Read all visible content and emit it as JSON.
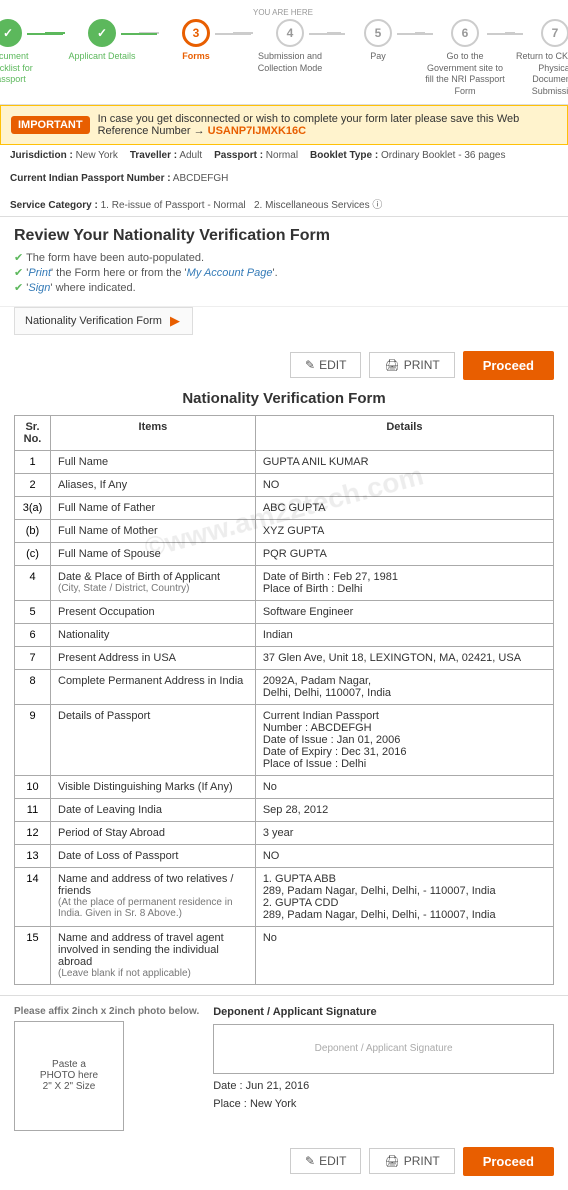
{
  "meta": {
    "you_are_here": "YOU ARE HERE"
  },
  "progress": {
    "steps": [
      {
        "id": 1,
        "label": "Document Checklist for Passport",
        "state": "completed",
        "check": true
      },
      {
        "id": 2,
        "label": "Applicant Details",
        "state": "completed",
        "check": true
      },
      {
        "id": 3,
        "label": "Forms",
        "state": "active"
      },
      {
        "id": 4,
        "label": "Submission and Collection Mode",
        "state": "future"
      },
      {
        "id": 5,
        "label": "Pay",
        "state": "future"
      },
      {
        "id": 6,
        "label": "Go to the Government site to fill the NRI Passport Form",
        "state": "future"
      },
      {
        "id": 7,
        "label": "Return to CKGS for Physical Documents Submission",
        "state": "future"
      }
    ]
  },
  "banner": {
    "label": "IMPORTANT",
    "text": "In case you get disconnected or wish to complete your form later please save this Web Reference Number →",
    "ref_number": "USANP7IJMXK16C"
  },
  "jurisdiction": {
    "jurisdiction_label": "Jurisdiction",
    "jurisdiction_value": "New York",
    "traveller_label": "Traveller",
    "traveller_value": "Adult",
    "passport_label": "Passport",
    "passport_value": "Normal",
    "booklet_label": "Booklet Type",
    "booklet_value": "Ordinary Booklet - 36 pages",
    "passport_number_label": "Current Indian Passport Number",
    "passport_number_value": "ABCDEFGH",
    "service_label": "Service Category",
    "service_value": "1. Re-issue of Passport - Normal\n2. Miscellaneous Services"
  },
  "review": {
    "title": "Review Your Nationality Verification Form",
    "checklist": [
      "The form have been auto-populated.",
      "'Print' the Form here or from the 'My Account Page'.",
      "'Sign' where indicated."
    ]
  },
  "form_tab": {
    "label": "Nationality Verification Form"
  },
  "buttons": {
    "edit": "EDIT",
    "print": "PRINT",
    "proceed": "Proceed"
  },
  "form": {
    "title": "Nationality Verification Form",
    "headers": [
      "Sr. No.",
      "Items",
      "Details"
    ],
    "rows": [
      {
        "sr": "1",
        "item": "Full Name",
        "sub": "",
        "detail": "GUPTA ANIL KUMAR"
      },
      {
        "sr": "2",
        "item": "Aliases, If Any",
        "sub": "",
        "detail": "NO"
      },
      {
        "sr": "3(a)",
        "item": "Full Name of Father",
        "sub": "",
        "detail": "ABC GUPTA"
      },
      {
        "sr": "(b)",
        "item": "Full Name of Mother",
        "sub": "",
        "detail": "XYZ GUPTA"
      },
      {
        "sr": "(c)",
        "item": "Full Name of Spouse",
        "sub": "",
        "detail": "PQR GUPTA"
      },
      {
        "sr": "4",
        "item": "Date & Place of Birth of Applicant",
        "sub": "(City, State / District, Country)",
        "detail": "Date of Birth : Feb 27, 1981\nPlace of Birth : Delhi"
      },
      {
        "sr": "5",
        "item": "Present Occupation",
        "sub": "",
        "detail": "Software Engineer"
      },
      {
        "sr": "6",
        "item": "Nationality",
        "sub": "",
        "detail": "Indian"
      },
      {
        "sr": "7",
        "item": "Present Address in USA",
        "sub": "",
        "detail": "37 Glen Ave, Unit 18, LEXINGTON, MA, 02421, USA"
      },
      {
        "sr": "8",
        "item": "Complete Permanent Address in India",
        "sub": "",
        "detail": "2092A, Padam Nagar,\nDelhi, Delhi, 110007, India"
      },
      {
        "sr": "9",
        "item": "Details of Passport",
        "sub": "",
        "detail": "Current Indian Passport\nNumber : ABCDEFGH\nDate of Issue : Jan 01, 2006\nDate of Expiry : Dec 31, 2016\nPlace of Issue : Delhi"
      },
      {
        "sr": "10",
        "item": "Visible Distinguishing Marks (If Any)",
        "sub": "",
        "detail": "No"
      },
      {
        "sr": "11",
        "item": "Date of Leaving India",
        "sub": "",
        "detail": "Sep 28, 2012"
      },
      {
        "sr": "12",
        "item": "Period of Stay Abroad",
        "sub": "",
        "detail": "3 year"
      },
      {
        "sr": "13",
        "item": "Date of Loss of Passport",
        "sub": "",
        "detail": "NO"
      },
      {
        "sr": "14",
        "item": "Name and address of two relatives / friends",
        "sub": "(At the place of permanent residence in India. Given in Sr. 8 Above.)",
        "detail": "1. GUPTA ABB\n289, Padam Nagar, Delhi, Delhi, - 110007, India\n2. GUPTA CDD\n289, Padam Nagar, Delhi, Delhi, - 110007, India"
      },
      {
        "sr": "15",
        "item": "Name and address of travel agent involved in sending the individual abroad",
        "sub": "(Leave blank if not applicable)",
        "detail": "No"
      }
    ]
  },
  "photo_section": {
    "label": "Please affix 2inch x 2inch photo below.",
    "photo_text": "Paste a\nPHOTO here\n2\" X 2\" Size",
    "signature_title": "Deponent / Applicant Signature",
    "signature_placeholder": "Deponent / Applicant Signature",
    "date_label": "Date :",
    "date_value": "Jun 21, 2016",
    "place_label": "Place :",
    "place_value": "New York"
  },
  "watermark": "©www.am22tech.com"
}
